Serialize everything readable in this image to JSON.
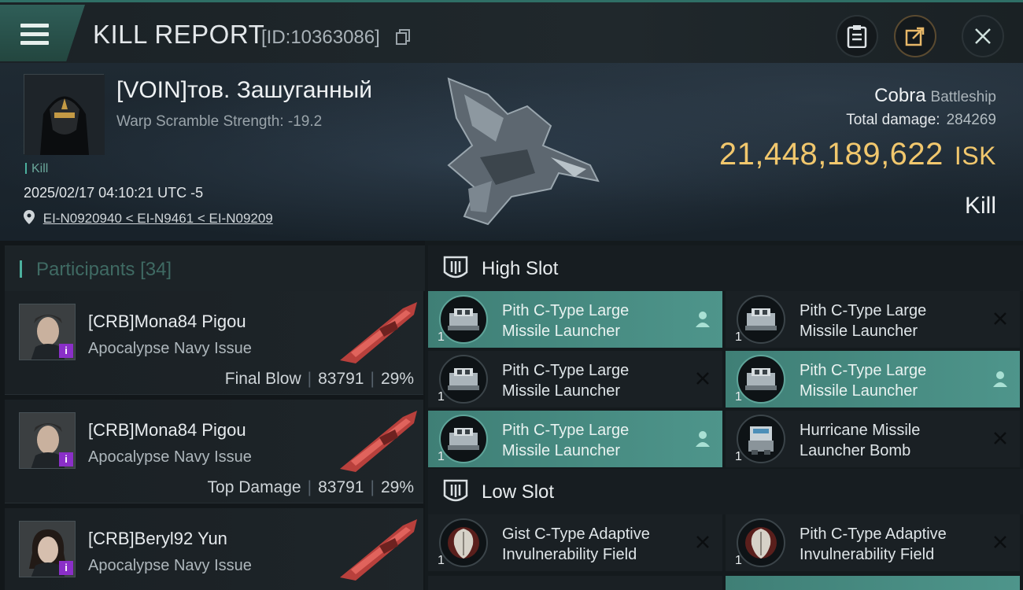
{
  "header": {
    "title": "KILL REPORT",
    "report_id": "[ID:10363086]",
    "icons": [
      "menu-icon",
      "copy-icon",
      "clipboard-icon",
      "share-icon",
      "close-icon"
    ]
  },
  "victim": {
    "name": "[VOIN]тов. Зашуганный",
    "warp_scramble": "Warp Scramble Strength: -19.2",
    "kill_tag": "Kill",
    "datetime": "2025/02/17 04:10:21 UTC -5",
    "location": "EI-N0920940 < EI-N9461 < EI-N09209",
    "ship_name": "Cobra",
    "ship_class": "Battleship",
    "total_damage_label": "Total damage:",
    "total_damage": "284269",
    "isk_value": "21,448,189,622",
    "isk_unit": "ISK",
    "result": "Kill"
  },
  "participants": {
    "title": "Participants",
    "count": "[34]",
    "rows": [
      {
        "name": "[CRB]Mona84 Pigou",
        "ship": "Apocalypse Navy Issue",
        "role": "Final Blow",
        "damage": "83791",
        "percent": "29%",
        "badge": "i"
      },
      {
        "name": "[CRB]Mona84 Pigou",
        "ship": "Apocalypse Navy Issue",
        "role": "Top Damage",
        "damage": "83791",
        "percent": "29%",
        "badge": "i"
      },
      {
        "name": "[CRB]Beryl92 Yun",
        "ship": "Apocalypse Navy Issue",
        "role": "",
        "damage": "",
        "percent": "",
        "badge": "i"
      }
    ]
  },
  "fitting": {
    "high_slot": {
      "title": "High Slot",
      "modules": [
        {
          "line1": "Pith C-Type Large",
          "line2": "Missile Launcher",
          "qty": "1",
          "state": "dropped"
        },
        {
          "line1": "Pith C-Type Large",
          "line2": "Missile Launcher",
          "qty": "1",
          "state": "destroyed"
        },
        {
          "line1": "Pith C-Type Large",
          "line2": "Missile Launcher",
          "qty": "1",
          "state": "destroyed"
        },
        {
          "line1": "Pith C-Type Large",
          "line2": "Missile Launcher",
          "qty": "1",
          "state": "dropped"
        },
        {
          "line1": "Pith C-Type Large",
          "line2": "Missile Launcher",
          "qty": "1",
          "state": "dropped"
        },
        {
          "line1": "Hurricane Missile",
          "line2": "Launcher Bomb",
          "qty": "1",
          "state": "destroyed"
        }
      ]
    },
    "low_slot": {
      "title": "Low Slot",
      "modules": [
        {
          "line1": "Gist C-Type Adaptive",
          "line2": "Invulnerability Field",
          "qty": "1",
          "state": "destroyed"
        },
        {
          "line1": "Pith C-Type Adaptive",
          "line2": "Invulnerability Field",
          "qty": "1",
          "state": "destroyed"
        }
      ]
    }
  },
  "colors": {
    "accent": "#4cb09e",
    "highlight_row": "#4e958b",
    "isk": "#f1c76d",
    "badge": "#8a2fc8"
  }
}
